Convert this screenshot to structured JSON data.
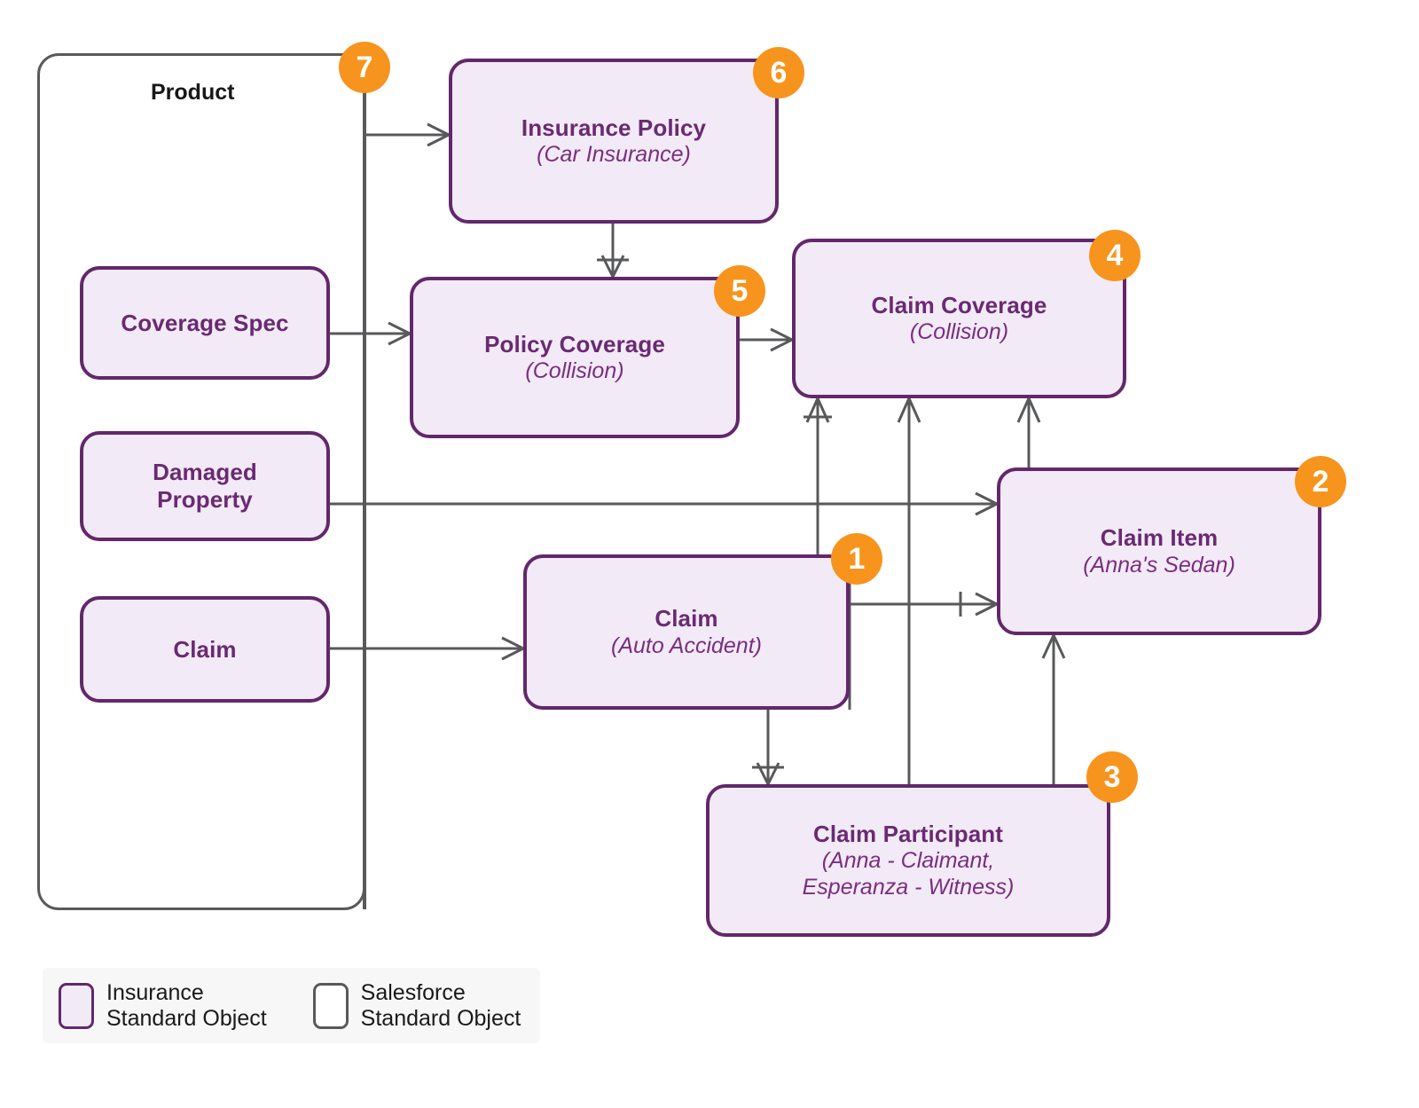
{
  "diagram": {
    "title_group": "Product",
    "nodes": [
      {
        "id": "coverage-spec",
        "title": "Coverage Spec",
        "subtitle": "",
        "badge": ""
      },
      {
        "id": "damaged-property",
        "title": "Damaged Property",
        "subtitle": "",
        "badge": ""
      },
      {
        "id": "claim-left",
        "title": "Claim",
        "subtitle": "",
        "badge": ""
      },
      {
        "id": "insurance-policy",
        "title": "Insurance Policy",
        "subtitle": "(Car Insurance)",
        "badge": "6"
      },
      {
        "id": "policy-coverage",
        "title": "Policy Coverage",
        "subtitle": "(Collision)",
        "badge": "5"
      },
      {
        "id": "claim-coverage",
        "title": "Claim Coverage",
        "subtitle": "(Collision)",
        "badge": "4"
      },
      {
        "id": "claim-item",
        "title": "Claim Item",
        "subtitle": "(Anna's Sedan)",
        "badge": "2"
      },
      {
        "id": "claim",
        "title": "Claim",
        "subtitle": "(Auto Accident)",
        "badge": "1"
      },
      {
        "id": "claim-participant",
        "title": "Claim Participant",
        "subtitle": "(Anna - Claimant,\nEsperanza - Witness)",
        "badge": "3"
      }
    ],
    "group_badge": "7",
    "legend": [
      {
        "id": "insurance-standard-object",
        "label": "Insurance\nStandard Object",
        "style": "insurance"
      },
      {
        "id": "salesforce-standard-object",
        "label": "Salesforce\nStandard Object",
        "style": "salesforce"
      }
    ],
    "colors": {
      "object_fill": "#F2EAF6",
      "object_border": "#63276B",
      "object_text": "#6A2A72",
      "group_border": "#58595B",
      "badge_bg": "#F7941D",
      "badge_text": "#FFFFFF",
      "connector": "#58595B",
      "legend_bg": "#F7F7F8"
    }
  }
}
